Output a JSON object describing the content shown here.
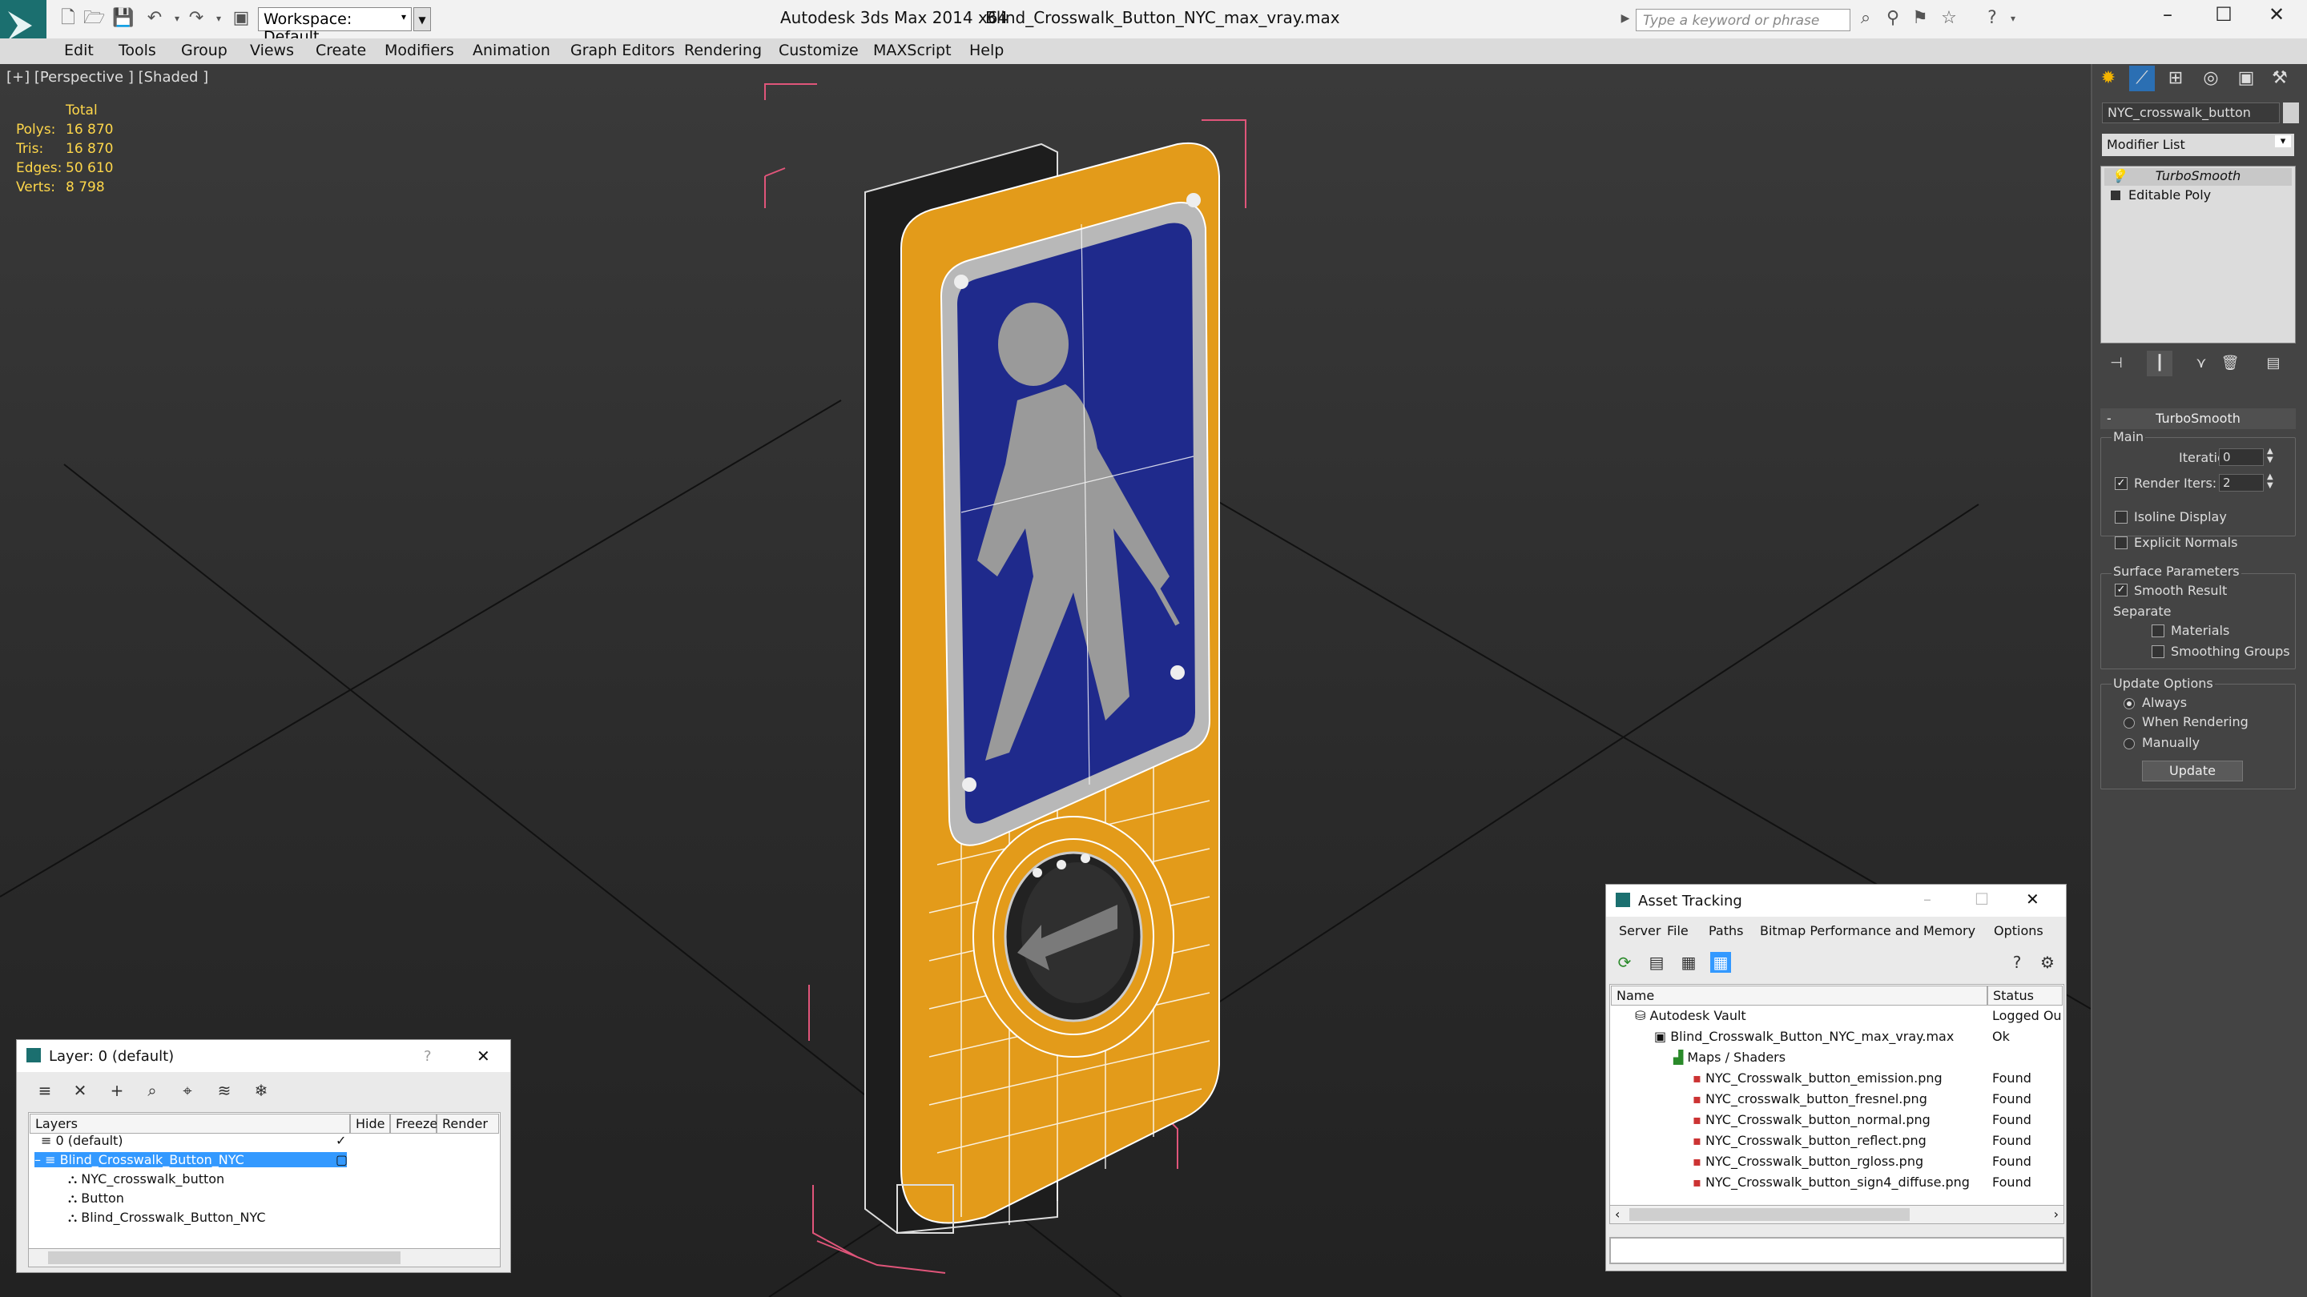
{
  "titlebar": {
    "app_title": "Autodesk 3ds Max  2014 x64",
    "file_title": "Blind_Crosswalk_Button_NYC_max_vray.max",
    "workspace_label": "Workspace: Default",
    "search_placeholder": "Type a keyword or phrase",
    "window_controls": [
      "minimize-icon",
      "maximize-icon",
      "close-icon"
    ]
  },
  "menubar": {
    "items": [
      "Edit",
      "Tools",
      "Group",
      "Views",
      "Create",
      "Modifiers",
      "Animation",
      "Graph Editors",
      "Rendering",
      "Customize",
      "MAXScript",
      "Help"
    ]
  },
  "viewport": {
    "label": "[+] [Perspective ] [Shaded ]",
    "stats": {
      "header": "Total",
      "rows": [
        {
          "label": "Polys:",
          "value": "16 870"
        },
        {
          "label": "Tris:",
          "value": "16 870"
        },
        {
          "label": "Edges:",
          "value": "50 610"
        },
        {
          "label": "Verts:",
          "value": "8 798"
        }
      ]
    }
  },
  "command_panel": {
    "object_name": "NYC_crosswalk_button",
    "modifier_list_label": "Modifier List",
    "stack": [
      "TurboSmooth",
      "Editable Poly"
    ],
    "turbosmooth": {
      "title": "TurboSmooth",
      "main_label": "Main",
      "iterations_label": "Iterations:",
      "iterations_value": "0",
      "render_iters_label": "Render Iters:",
      "render_iters_value": "2",
      "render_iters_checked": true,
      "isoline_label": "Isoline Display",
      "explicit_normals_label": "Explicit Normals",
      "surface_params_label": "Surface Parameters",
      "smooth_result_label": "Smooth Result",
      "separate_label": "Separate",
      "materials_label": "Materials",
      "smoothing_groups_label": "Smoothing Groups",
      "update_options_label": "Update Options",
      "always_label": "Always",
      "when_rendering_label": "When Rendering",
      "manually_label": "Manually",
      "update_button": "Update"
    }
  },
  "layer_window": {
    "title": "Layer: 0 (default)",
    "help": "?",
    "columns": [
      "Layers",
      "Hide",
      "Freeze",
      "Render"
    ],
    "rows": [
      {
        "name": "0 (default)",
        "indent": 1
      },
      {
        "name": "Blind_Crosswalk_Button_NYC",
        "indent": 1,
        "selected": true
      },
      {
        "name": "NYC_crosswalk_button",
        "indent": 2
      },
      {
        "name": "Button",
        "indent": 2
      },
      {
        "name": "Blind_Crosswalk_Button_NYC",
        "indent": 2
      }
    ]
  },
  "asset_window": {
    "title": "Asset Tracking",
    "menu": [
      "Server",
      "File",
      "Paths",
      "Bitmap Performance and Memory",
      "Options"
    ],
    "columns": [
      "Name",
      "Status"
    ],
    "rows": [
      {
        "name": "Autodesk Vault",
        "status": "Logged Ou",
        "indent": 1
      },
      {
        "name": "Blind_Crosswalk_Button_NYC_max_vray.max",
        "status": "Ok",
        "indent": 2
      },
      {
        "name": "Maps / Shaders",
        "status": "",
        "indent": 3
      },
      {
        "name": "NYC_Crosswalk_button_emission.png",
        "status": "Found",
        "indent": 4
      },
      {
        "name": "NYC_crosswalk_button_fresnel.png",
        "status": "Found",
        "indent": 4
      },
      {
        "name": "NYC_Crosswalk_button_normal.png",
        "status": "Found",
        "indent": 4
      },
      {
        "name": "NYC_Crosswalk_button_reflect.png",
        "status": "Found",
        "indent": 4
      },
      {
        "name": "NYC_Crosswalk_button_rgloss.png",
        "status": "Found",
        "indent": 4
      },
      {
        "name": "NYC_Crosswalk_button_sign4_diffuse.png",
        "status": "Found",
        "indent": 4
      }
    ]
  },
  "colors": {
    "accent_orange": "#e39b1a",
    "sign_blue": "#1f2a8c",
    "selection": "#3399ff",
    "stats_yellow": "#ffd74a"
  }
}
